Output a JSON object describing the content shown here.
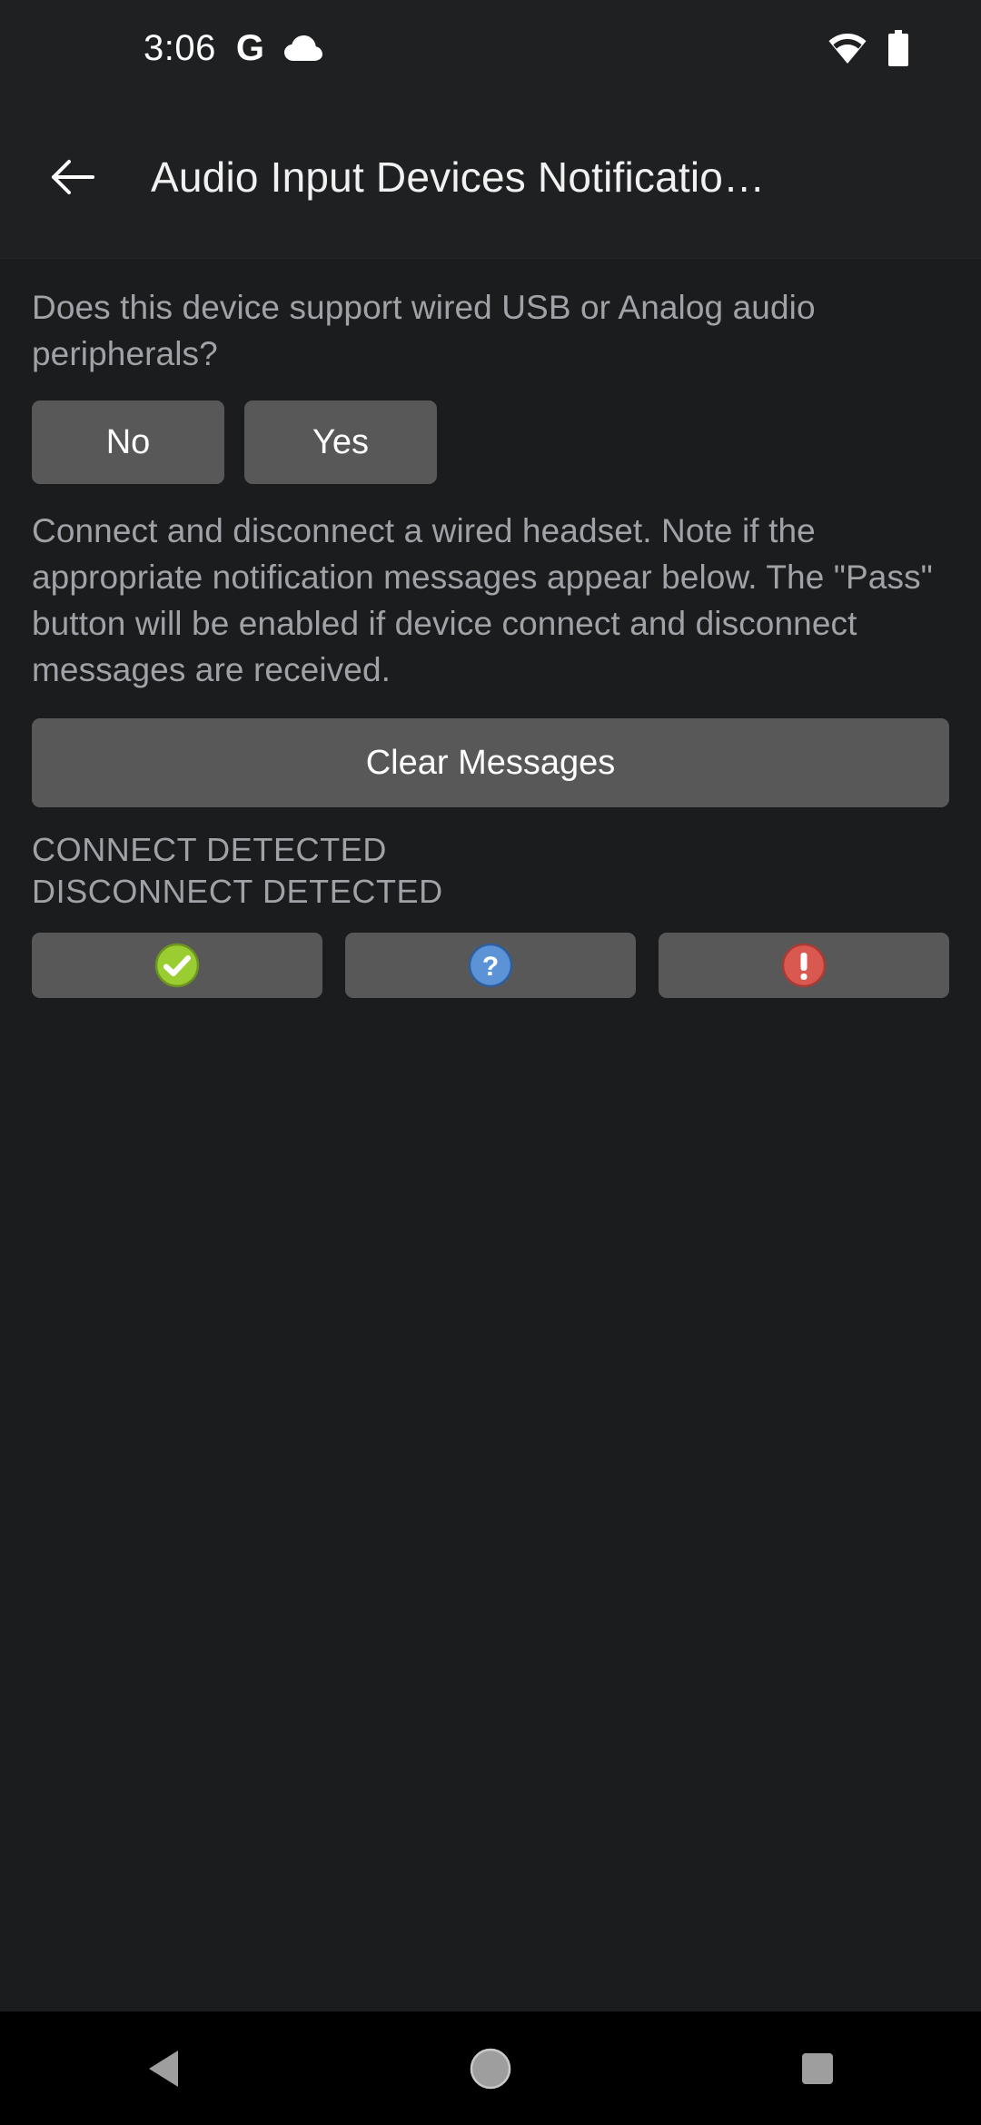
{
  "status_bar": {
    "clock": "3:06",
    "left_icons": [
      "google-g-icon",
      "cloud-icon"
    ],
    "right_icons": [
      "wifi-icon",
      "battery-icon"
    ]
  },
  "app_bar": {
    "back_icon": "arrow-back-icon",
    "title": "Audio Input Devices Notificatio…"
  },
  "content": {
    "question": "Does this device support wired USB or Analog audio peripherals?",
    "answer_buttons": [
      {
        "label": "No",
        "name": "no-button"
      },
      {
        "label": "Yes",
        "name": "yes-button"
      }
    ],
    "instructions": "Connect and disconnect a wired headset. Note if the appropriate notification messages appear below. The \"Pass\" button will be enabled if device connect and disconnect messages are received.",
    "clear_button_label": "Clear Messages",
    "status_messages": [
      "CONNECT DETECTED",
      "DISCONNECT DETECTED"
    ],
    "verdict_buttons": [
      {
        "name": "pass-button",
        "icon": "check-circle-icon",
        "color": "#9acd32"
      },
      {
        "name": "info-button",
        "icon": "question-circle-icon",
        "color": "#4b86c8"
      },
      {
        "name": "fail-button",
        "icon": "exclamation-circle-icon",
        "color": "#d9534f"
      }
    ]
  },
  "nav_bar": {
    "back": "nav-back-icon",
    "home": "nav-home-icon",
    "recents": "nav-recents-icon"
  },
  "colors": {
    "screen_background": "#1b1c1e",
    "bar_background": "#1f2022",
    "button_grey": "#585858",
    "body_text": "#9fa2a6",
    "title_text": "#f1f1f1",
    "nav_background": "#000000",
    "nav_icon": "#9e9e9e"
  }
}
